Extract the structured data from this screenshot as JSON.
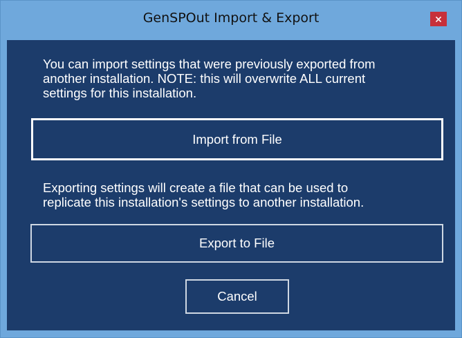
{
  "window": {
    "title": "GenSPOut Import & Export",
    "close_icon": "close-icon"
  },
  "import_section": {
    "message": "You can import settings that were previously exported from\nanother installation.  NOTE:  this will overwrite ALL current\nsettings for this installation.",
    "button_label": "Import from File"
  },
  "export_section": {
    "message": "Exporting settings will create a file that can be used to\nreplicate this installation's settings to another installation.",
    "button_label": "Export to File"
  },
  "cancel_label": "Cancel",
  "colors": {
    "frame": "#6fa8dc",
    "client_background": "#1c3c6b",
    "close_button": "#c7303a",
    "text": "#ffffff"
  }
}
